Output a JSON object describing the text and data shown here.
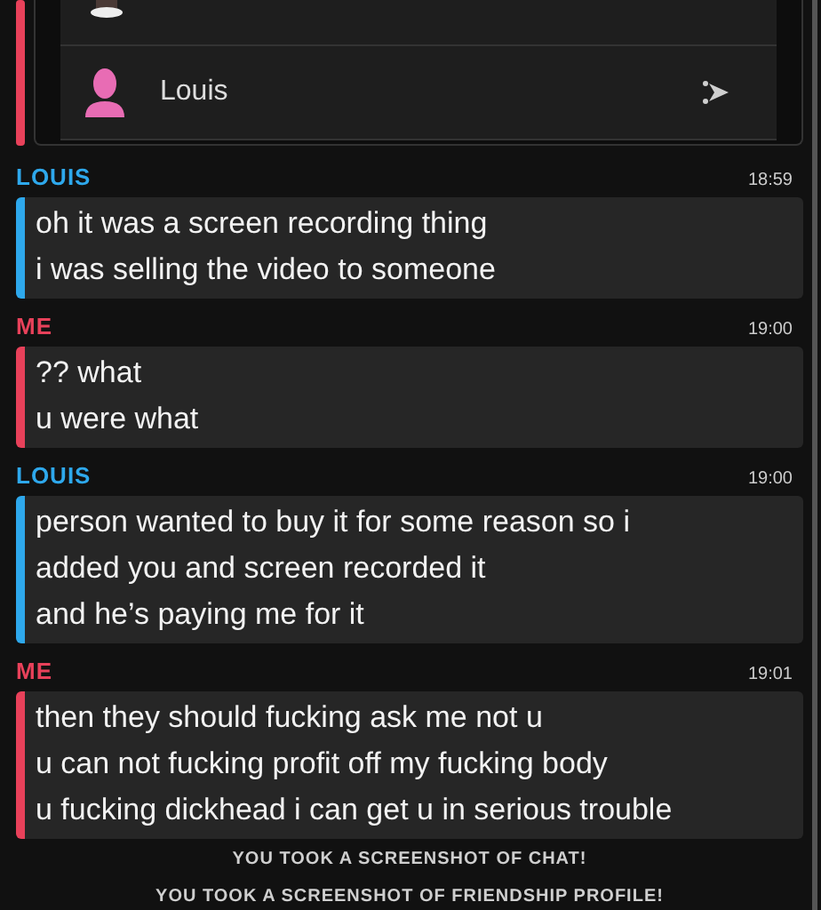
{
  "shared_card": {
    "contact": {
      "name": "Louis"
    }
  },
  "messages": [
    {
      "sender": "LOUIS",
      "kind": "friend",
      "time": "18:59",
      "lines": [
        "oh it was a screen recording thing",
        "i was selling the video to someone"
      ]
    },
    {
      "sender": "ME",
      "kind": "me",
      "time": "19:00",
      "lines": [
        "?? what",
        "u were what"
      ]
    },
    {
      "sender": "LOUIS",
      "kind": "friend",
      "time": "19:00",
      "lines": [
        "person wanted to buy it for some reason so i",
        "added you and screen recorded it",
        "and he’s paying me for it"
      ]
    },
    {
      "sender": "ME",
      "kind": "me",
      "time": "19:01",
      "lines": [
        "then they should fucking ask me not u",
        "u can not fucking profit off my fucking body",
        "u fucking dickhead i can get u in serious trouble"
      ]
    }
  ],
  "notices": [
    "YOU TOOK A SCREENSHOT OF CHAT!",
    "YOU TOOK A SCREENSHOT OF FRIENDSHIP PROFILE!"
  ]
}
